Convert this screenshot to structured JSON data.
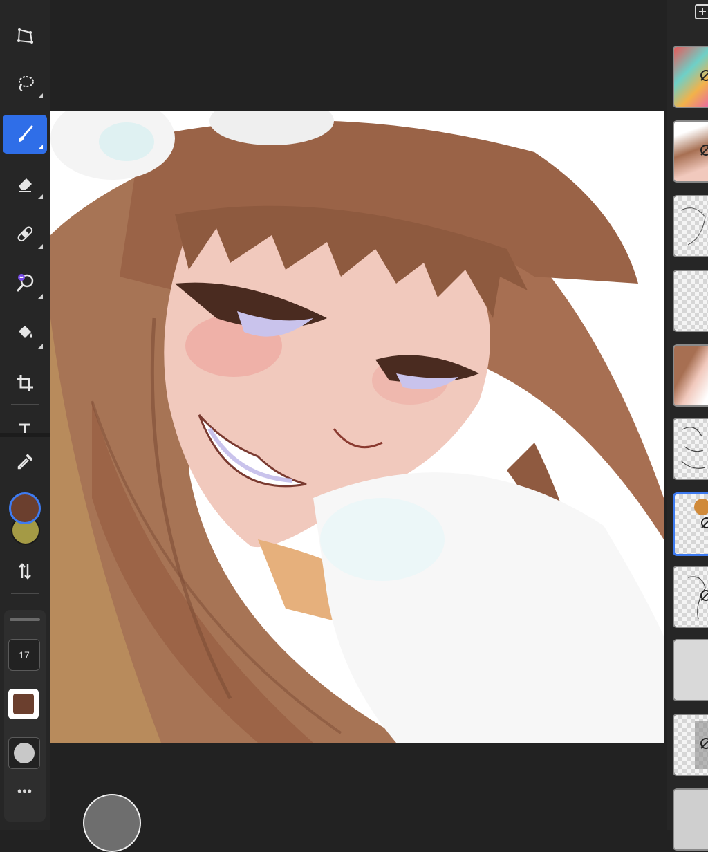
{
  "toolbar": {
    "tools": [
      "transform",
      "lasso-select",
      "brush",
      "eraser",
      "smudge",
      "magic-wand",
      "fill",
      "crop",
      "text"
    ],
    "active_tool": "brush"
  },
  "colors": {
    "primary": "#6b3f2e",
    "secondary": "#a49a45",
    "accent": "#2f6ee8"
  },
  "brush_panel": {
    "size_value": "17",
    "more_label": "•••"
  },
  "layers": {
    "count": 11,
    "selected_index": 6
  }
}
